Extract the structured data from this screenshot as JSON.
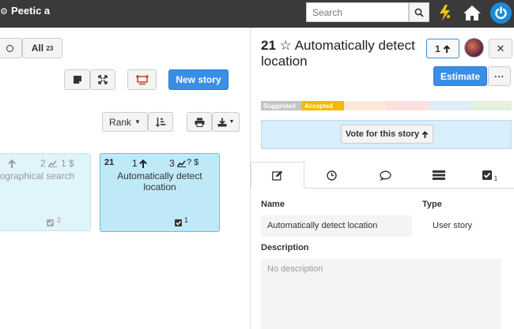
{
  "header": {
    "brand": "Peetic a",
    "search_placeholder": "Search",
    "tooltip": "Vote for this story"
  },
  "toolbar": {
    "all_label": "All",
    "all_count": "23",
    "new_story": "New story",
    "rank": "Rank"
  },
  "board": {
    "cards": [
      {
        "title": "ographical search",
        "votes": "2",
        "points": "1 $",
        "tasks": "2"
      },
      {
        "id": "21",
        "votes": "1",
        "points": "3",
        "points_suffix": "? $",
        "title_line1": "Automatically detect",
        "title_line2": "location",
        "tasks": "1"
      }
    ]
  },
  "detail": {
    "id": "21",
    "title_line1": "Automatically detect",
    "title_line2": "location",
    "vote_count": "1",
    "estimate": "Estimate",
    "state_suggested": "Suggested",
    "state_accepted": "Accepted",
    "vote_button": "Vote for this story",
    "tasks_tab_count": "1",
    "name_label": "Name",
    "name_value": "Automatically detect location",
    "type_label": "Type",
    "type_value": "User story",
    "description_label": "Description",
    "description_placeholder": "No description"
  },
  "colors": {
    "topbar": "#3a3a3a",
    "primary": "#3a8ee6",
    "accepted": "#f5b800",
    "suggested": "#c4c4c4",
    "card_blue": "#bfe9f7"
  }
}
